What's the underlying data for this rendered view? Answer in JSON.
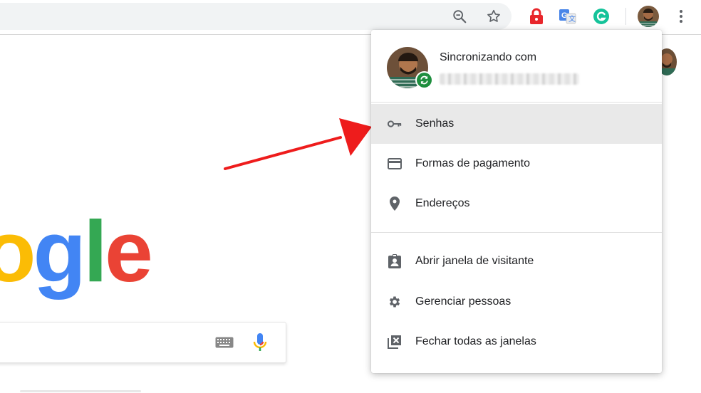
{
  "toolbar": {
    "icons": [
      "zoom-out-icon",
      "star-icon",
      "lock-extension-icon",
      "translate-icon",
      "grammarly-icon",
      "profile-avatar",
      "more-vert-icon"
    ]
  },
  "page": {
    "logo_letters": [
      "o",
      "g",
      "l",
      "e"
    ],
    "logo_colors": [
      "#fbbc05",
      "#4285f4",
      "#34a853",
      "#ea4335"
    ]
  },
  "menu": {
    "sync_label": "Sincronizando com",
    "items": [
      {
        "label": "Senhas",
        "icon": "key-icon"
      },
      {
        "label": "Formas de pagamento",
        "icon": "credit-card-icon"
      },
      {
        "label": "Endereços",
        "icon": "location-pin-icon"
      },
      {
        "label": "Abrir janela de visitante",
        "icon": "guest-badge-icon"
      },
      {
        "label": "Gerenciar pessoas",
        "icon": "gear-icon"
      },
      {
        "label": "Fechar todas as janelas",
        "icon": "close-windows-icon"
      }
    ]
  },
  "colors": {
    "arrow": "#ee1c1c",
    "sync_badge": "#1e8e3e",
    "highlight": "#e9e9e9"
  }
}
